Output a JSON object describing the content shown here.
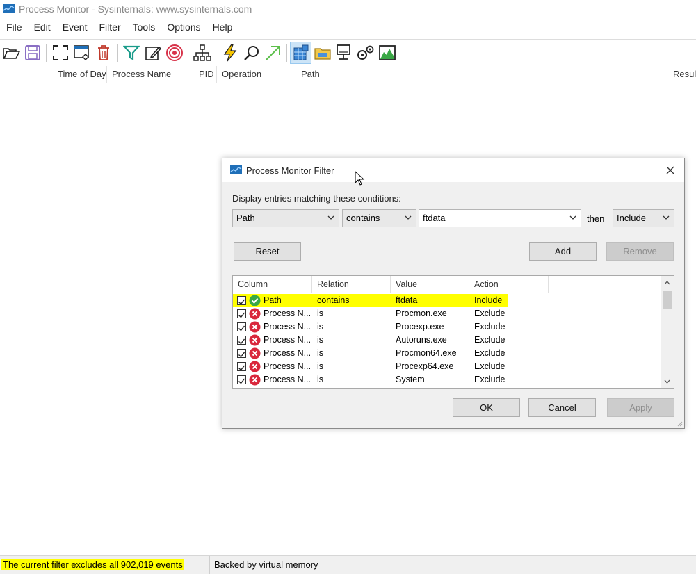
{
  "window": {
    "title": "Process Monitor - Sysinternals: www.sysinternals.com"
  },
  "menu": [
    "File",
    "Edit",
    "Event",
    "Filter",
    "Tools",
    "Options",
    "Help"
  ],
  "toolbar": {
    "icons": [
      "open-icon",
      "save-icon",
      "autoscroll-icon",
      "capture-icon",
      "clear-icon",
      "filter-icon",
      "highlight-icon",
      "target-icon",
      "process-tree-icon",
      "jump-icon",
      "find-icon",
      "jump-to-icon",
      "registry-activity-icon",
      "file-activity-icon",
      "network-activity-icon",
      "process-activity-icon",
      "profiling-activity-icon"
    ]
  },
  "columns": {
    "time": "Time of Day",
    "process": "Process Name",
    "pid": "PID",
    "operation": "Operation",
    "path": "Path",
    "result": "Result"
  },
  "status": {
    "filter_msg": "The current filter excludes all 902,019 events",
    "memory": "Backed by virtual memory"
  },
  "dialog": {
    "title": "Process Monitor Filter",
    "label": "Display entries matching these conditions:",
    "column_value": "Path",
    "relation_value": "contains",
    "value_value": "ftdata",
    "then_label": "then",
    "action_value": "Include",
    "reset": "Reset",
    "add": "Add",
    "remove": "Remove",
    "ok": "OK",
    "cancel": "Cancel",
    "apply": "Apply",
    "list_headers": [
      "Column",
      "Relation",
      "Value",
      "Action"
    ],
    "rows": [
      {
        "column": "Path",
        "relation": "contains",
        "value": "ftdata",
        "action": "Include",
        "type": "include"
      },
      {
        "column": "Process N...",
        "relation": "is",
        "value": "Procmon.exe",
        "action": "Exclude",
        "type": "exclude"
      },
      {
        "column": "Process N...",
        "relation": "is",
        "value": "Procexp.exe",
        "action": "Exclude",
        "type": "exclude"
      },
      {
        "column": "Process N...",
        "relation": "is",
        "value": "Autoruns.exe",
        "action": "Exclude",
        "type": "exclude"
      },
      {
        "column": "Process N...",
        "relation": "is",
        "value": "Procmon64.exe",
        "action": "Exclude",
        "type": "exclude"
      },
      {
        "column": "Process N...",
        "relation": "is",
        "value": "Procexp64.exe",
        "action": "Exclude",
        "type": "exclude"
      },
      {
        "column": "Process N...",
        "relation": "is",
        "value": "System",
        "action": "Exclude",
        "type": "exclude"
      }
    ]
  }
}
